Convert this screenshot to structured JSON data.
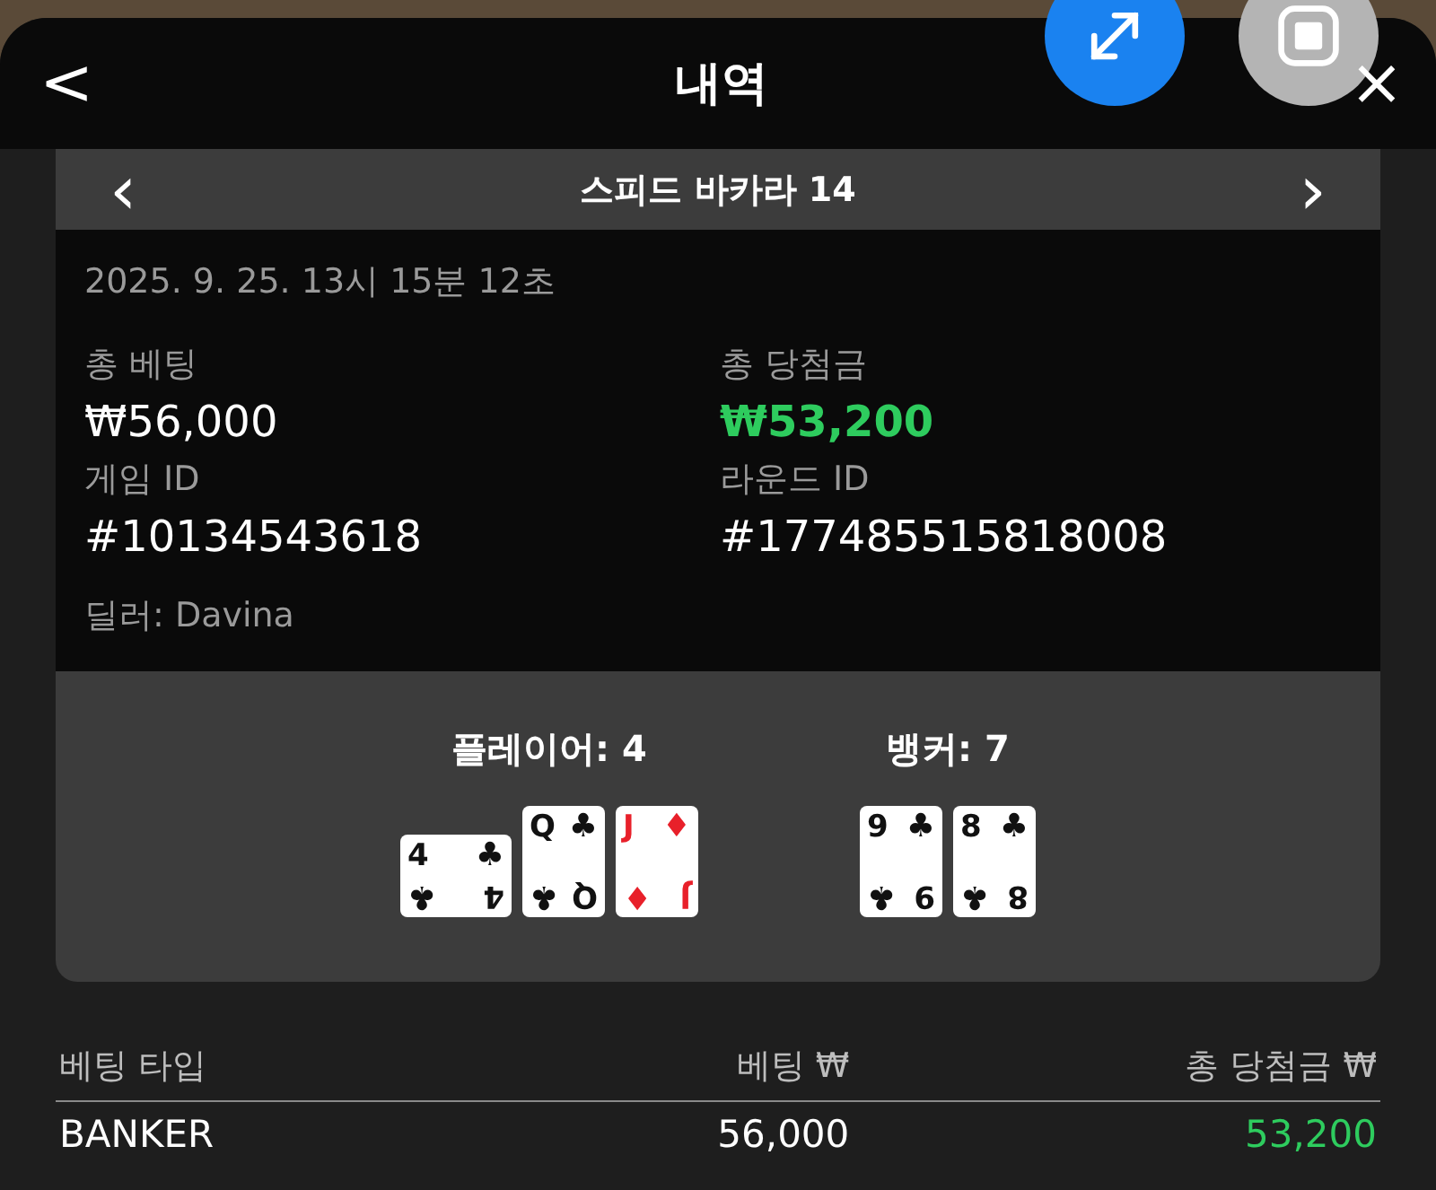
{
  "header": {
    "title": "내역",
    "back": "<",
    "close": "×"
  },
  "game": {
    "title": "스피드 바카라 14",
    "prev": "‹",
    "next": "›"
  },
  "details": {
    "datetime": "2025. 9. 25. 13시 15분 12초",
    "fields": [
      {
        "label": "총 베팅",
        "value": "₩56,000",
        "kind": "plain"
      },
      {
        "label": "총 당첨금",
        "value": "₩53,200",
        "kind": "win"
      },
      {
        "label": "게임 ID",
        "value": "#10134543618",
        "kind": "plain"
      },
      {
        "label": "라운드 ID",
        "value": "#177485515818008",
        "kind": "plain"
      }
    ],
    "dealer": "딜러: Davina"
  },
  "hands": [
    {
      "label": "플레이어: 4",
      "cards": [
        {
          "ranks": [
            "4",
            "4"
          ],
          "suits": [
            "♣",
            "♣"
          ],
          "color": "#111111",
          "rotated": true
        },
        {
          "ranks": [
            "Q",
            "Q"
          ],
          "suits": [
            "♣",
            "♣"
          ],
          "color": "#111111",
          "rotated": false
        },
        {
          "ranks": [
            "J",
            "J"
          ],
          "suits": [
            "♦",
            "♦"
          ],
          "color": "#e8202a",
          "rotated": false
        }
      ]
    },
    {
      "label": "뱅커: 7",
      "cards": [
        {
          "ranks": [
            "9",
            "9"
          ],
          "suits": [
            "♣",
            "♣"
          ],
          "color": "#111111",
          "rotated": false
        },
        {
          "ranks": [
            "8",
            "8"
          ],
          "suits": [
            "♣",
            "♣"
          ],
          "color": "#111111",
          "rotated": false
        }
      ]
    }
  ],
  "table": {
    "columns": [
      "베팅 타입",
      "베팅 ₩",
      "총 당첨금 ₩"
    ],
    "rows": [
      {
        "type": "BANKER",
        "bet": "56,000",
        "win": "53,200"
      }
    ]
  }
}
